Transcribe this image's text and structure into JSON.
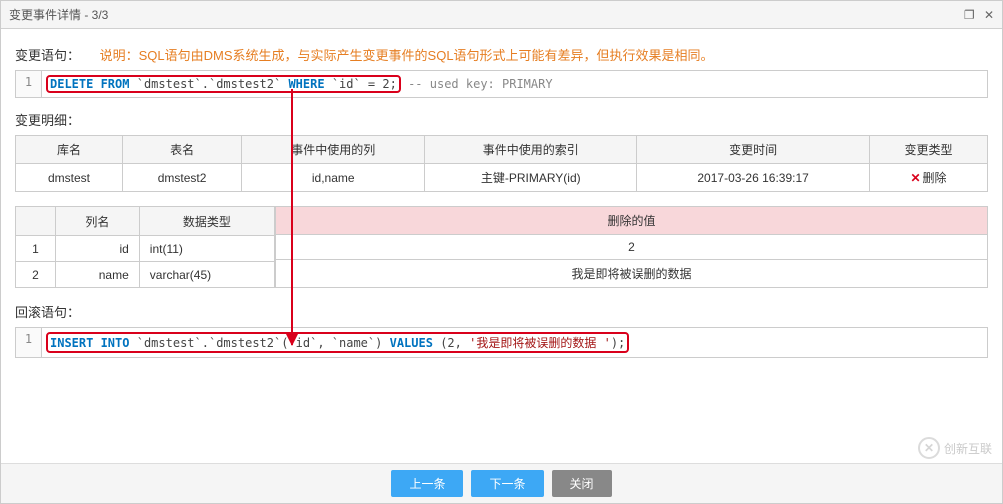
{
  "titlebar": {
    "title": "变更事件详情 - 3/3"
  },
  "change_stmt": {
    "label": "变更语句：",
    "note": "说明：SQL语句由DMS系统生成，与实际产生变更事件的SQL语句形式上可能有差异，但执行效果是相同。",
    "line_no": "1",
    "sql_kw1": "DELETE FROM",
    "sql_tbl": "`dmstest`.`dmstest2`",
    "sql_kw2": "WHERE",
    "sql_cond": "`id` = 2;",
    "sql_comment": "-- used key: PRIMARY"
  },
  "detail": {
    "label": "变更明细：",
    "headers": {
      "db": "库名",
      "table": "表名",
      "cols": "事件中使用的列",
      "idx": "事件中使用的索引",
      "time": "变更时间",
      "type": "变更类型"
    },
    "row": {
      "db": "dmstest",
      "table": "dmstest2",
      "cols": "id,name",
      "idx": "主键-PRIMARY(id)",
      "time": "2017-03-26 16:39:17",
      "type": "删除"
    }
  },
  "cols_detail": {
    "left_headers": {
      "idx": "",
      "name": "列名",
      "dtype": "数据类型"
    },
    "right_header": "删除的值",
    "rows": [
      {
        "n": "1",
        "name": "id",
        "dtype": "int(11)",
        "val": "2"
      },
      {
        "n": "2",
        "name": "name",
        "dtype": "varchar(45)",
        "val": "我是即将被误删的数据"
      }
    ]
  },
  "rollback": {
    "label": "回滚语句：",
    "line_no": "1",
    "sql_kw1": "INSERT INTO",
    "sql_tbl": "`dmstest`.`dmstest2`(",
    "sql_cols": "`id`, `name`",
    "sql_paren": ")",
    "sql_kw2": "VALUES",
    "sql_vals_open": "(2,",
    "sql_str": "'我是即将被误删的数据 '",
    "sql_close": ");"
  },
  "footer": {
    "prev": "上一条",
    "next": "下一条",
    "close": "关闭"
  },
  "watermark": "创新互联"
}
